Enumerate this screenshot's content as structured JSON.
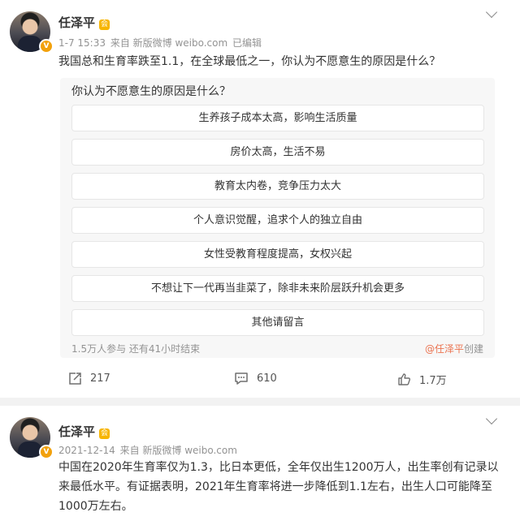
{
  "posts": [
    {
      "user": {
        "name": "任泽平",
        "verified_badge": "V",
        "member_badge": "会"
      },
      "meta": {
        "date": "1-7 15:33",
        "source": "来自 新版微博 weibo.com",
        "edited": "已编辑"
      },
      "text": "我国总和生育率跌至1.1，在全球最低之一，你认为不愿意生的原因是什么？",
      "poll": {
        "question": "你认为不愿意生的原因是什么？",
        "options": [
          "生养孩子成本太高，影响生活质量",
          "房价太高，生活不易",
          "教育太内卷，竞争压力太大",
          "个人意识觉醒，追求个人的独立自由",
          "女性受教育程度提高，女权兴起",
          "不想让下一代再当韭菜了，除非未来阶层跃升机会更多",
          "其他请留言"
        ],
        "stats": "1.5万人参与 还有41小时结束",
        "creator": "@任泽平",
        "creator_suffix": "创建"
      },
      "actions": {
        "reposts": "217",
        "comments": "610",
        "likes": "1.7万"
      }
    },
    {
      "user": {
        "name": "任泽平",
        "verified_badge": "V",
        "member_badge": "会"
      },
      "meta": {
        "date": "2021-12-14",
        "source": "来自 新版微博 weibo.com"
      },
      "text": "中国在2020年生育率仅为1.3，比日本更低，全年仅出生1200万人，出生率创有记录以来最低水平。有证据表明，2021年生育率将进一步降低到1.1左右，出生人口可能降至1000万左右。"
    }
  ],
  "colors": {
    "accent": "#eb7350",
    "meta": "#939393",
    "badge": "#f2a10c"
  },
  "icons": [
    "chevron-down-icon",
    "repost-icon",
    "comment-icon",
    "like-icon"
  ]
}
